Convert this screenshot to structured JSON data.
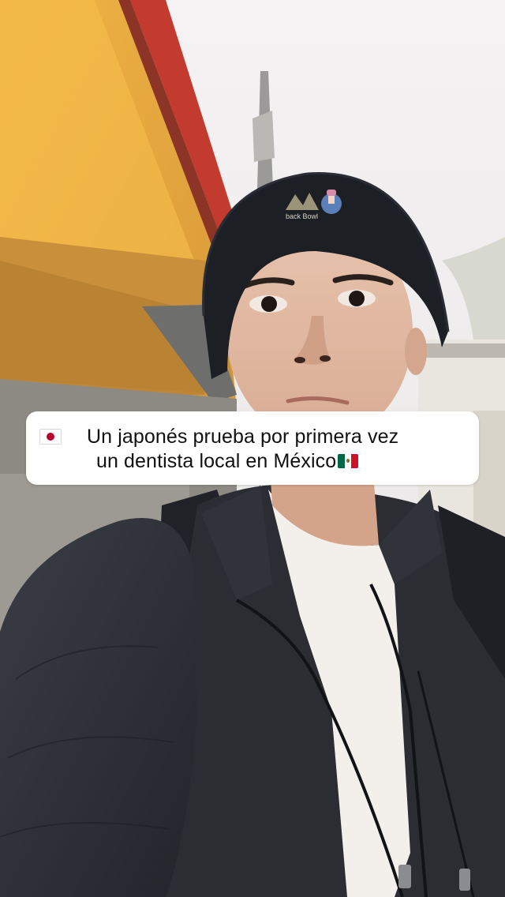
{
  "caption": {
    "flag_left": "japan-flag-icon",
    "line1": "Un japonés prueba por primera vez",
    "line2": "un dentista local en México",
    "flag_right": "mexico-flag-icon"
  },
  "photo": {
    "hat_logo_text": "back Bowl"
  },
  "colors": {
    "caption_background": "#ffffff",
    "caption_text": "#111111",
    "beanie": "#1c1f24",
    "jacket": "#2b2d33",
    "wall_orange": "#e5a33a"
  }
}
